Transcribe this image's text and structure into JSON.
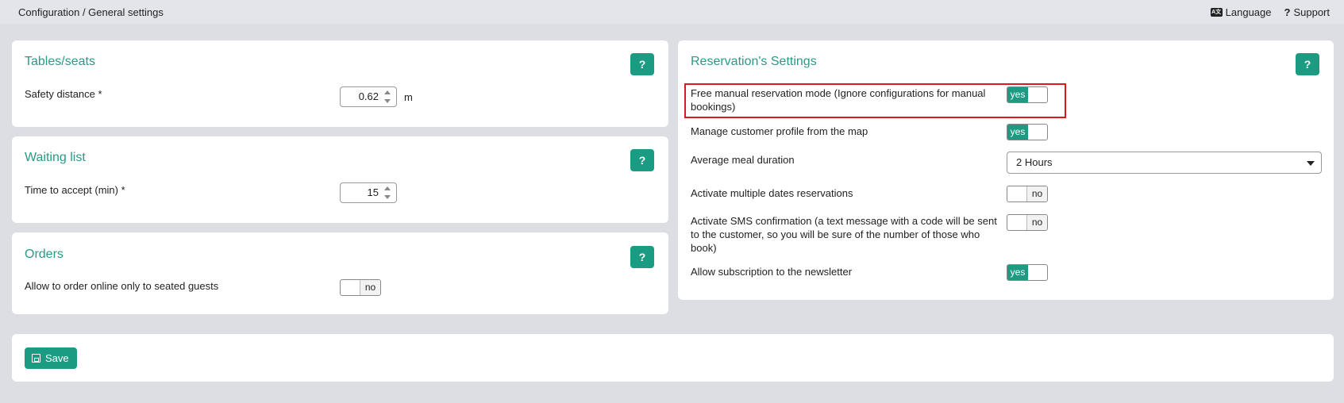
{
  "header": {
    "breadcrumb": "Configuration / General settings",
    "language_label": "Language",
    "support_label": "Support"
  },
  "tables_seats": {
    "title": "Tables/seats",
    "help": "?",
    "safety_distance_label": "Safety distance  *",
    "safety_distance_value": "0.62",
    "safety_distance_unit": "m"
  },
  "waiting_list": {
    "title": "Waiting list",
    "help": "?",
    "time_to_accept_label": "Time to accept (min)  *",
    "time_to_accept_value": "15"
  },
  "orders": {
    "title": "Orders",
    "help": "?",
    "online_seated_label": "Allow to order online only to seated guests",
    "online_seated_value": "no"
  },
  "reservation": {
    "title": "Reservation's Settings",
    "help": "?",
    "free_manual_label": "Free manual reservation mode (Ignore configurations for manual bookings)",
    "free_manual_value": "yes",
    "manage_profile_label": "Manage customer profile from the map",
    "manage_profile_value": "yes",
    "meal_duration_label": "Average meal duration",
    "meal_duration_value": "2 Hours",
    "multiple_dates_label": "Activate multiple dates reservations",
    "multiple_dates_value": "no",
    "sms_label": "Activate SMS confirmation (a text message with a code will be sent to the customer, so you will be sure of the number of those who book)",
    "sms_value": "no",
    "newsletter_label": "Allow subscription to the newsletter",
    "newsletter_value": "yes"
  },
  "footer": {
    "save_label": "Save"
  },
  "colors": {
    "accent": "#1a9b82",
    "title": "#2a9a86",
    "highlight": "#d81a1a"
  }
}
